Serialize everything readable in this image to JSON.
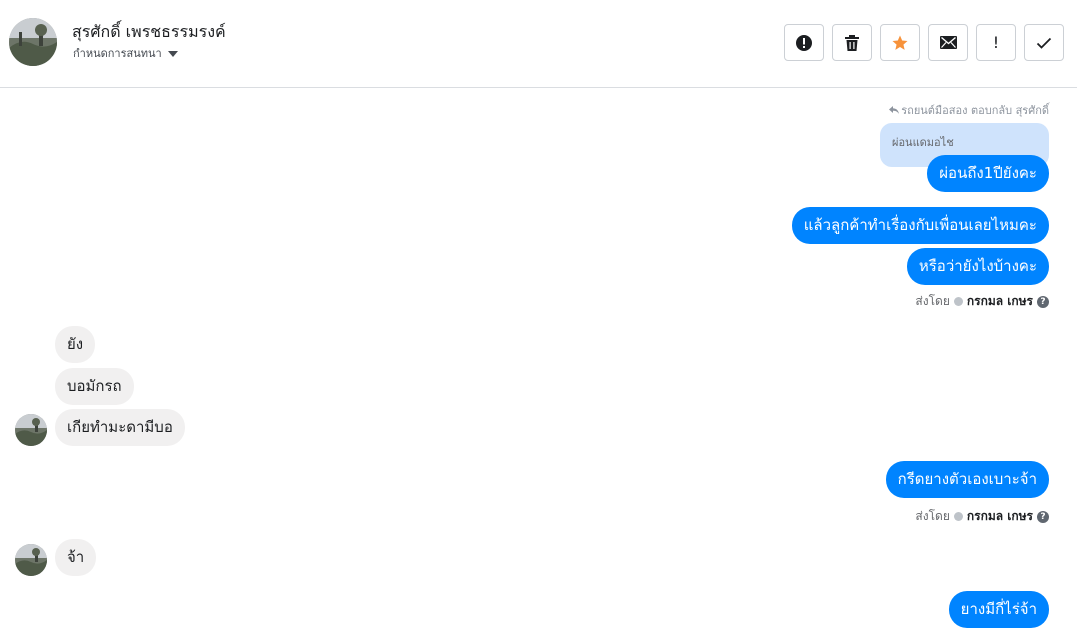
{
  "header": {
    "contact_name": "สุรศักดิ์ เพรชธรรมรงค์",
    "assign_label": "กำหนดการสนทนา",
    "toolbar": {
      "icons": [
        "alert-circle-icon",
        "trash-icon",
        "star-icon",
        "envelope-icon",
        "exclamation-icon",
        "check-icon"
      ],
      "star_color": "#f7923a",
      "exclamation_text": "!"
    }
  },
  "thread": {
    "reply_note": "รถยนต์มือสอง ตอบกลับ สุรศักดิ์",
    "quoted_message": "ผ่อนแดมอไช",
    "messages": [
      {
        "direction": "out",
        "text": "ผ่อนถึง1ปียังคะ"
      },
      {
        "direction": "out",
        "text": "แล้วลูกค้าทำเรื่องกับเพื่อนเลยไหมคะ"
      },
      {
        "direction": "out",
        "text": "หรือว่ายังไงบ้างคะ"
      },
      {
        "direction": "in",
        "text": "ยัง"
      },
      {
        "direction": "in",
        "text": "บอมักรถ"
      },
      {
        "direction": "in",
        "text": "เกียทำมะดามีบอ"
      },
      {
        "direction": "out",
        "text": "กรีดยางตัวเองเบาะจ้า"
      },
      {
        "direction": "in",
        "text": "จ้า"
      },
      {
        "direction": "out",
        "text": "ยางมีกี่ไร่จ้า"
      }
    ],
    "sent_by": {
      "prefix": "ส่งโดย",
      "agent": "กรกมล เกษร",
      "help": "?"
    }
  },
  "colors": {
    "outgoing_bubble": "#0084ff",
    "incoming_bubble": "#f1f0f0",
    "quoted_bubble": "#cfe3fc"
  }
}
